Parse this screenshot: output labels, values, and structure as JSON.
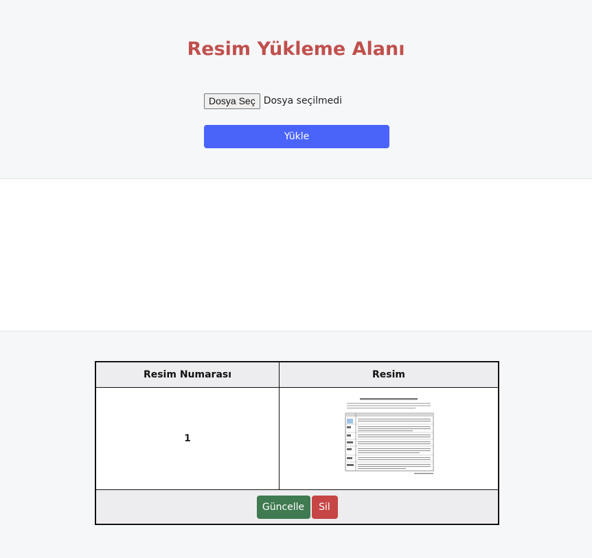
{
  "upload": {
    "title": "Resim Yükleme Alanı",
    "file_button_label": "Dosya Seç",
    "file_status": "Dosya seçilmedi",
    "upload_button_label": "Yükle"
  },
  "table": {
    "headers": [
      "Resim Numarası",
      "Resim"
    ],
    "rows": [
      {
        "number": "1",
        "image_icon": "document-thumbnail",
        "actions": {
          "update_label": "Güncelle",
          "delete_label": "Sil"
        }
      }
    ]
  },
  "colors": {
    "title": "#c0504d",
    "upload_button": "#4a64fa",
    "update_button": "#3f7a50",
    "delete_button": "#c64545"
  }
}
